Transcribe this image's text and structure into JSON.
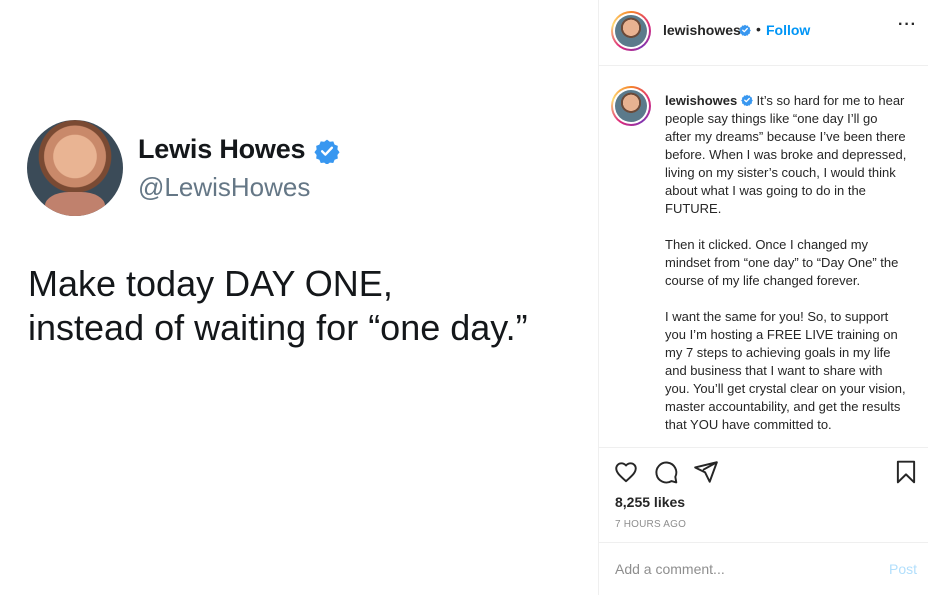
{
  "post_image": {
    "tweet_name": "Lewis Howes",
    "tweet_handle": "@LewisHowes",
    "tweet_line1": "Make today DAY ONE,",
    "tweet_line2": "instead of waiting for “one day.”"
  },
  "header": {
    "username": "lewishowes",
    "separator": "•",
    "follow_label": "Follow",
    "more_label": "···"
  },
  "caption": {
    "username": "lewishowes",
    "paragraph1": "It’s so hard for me to hear people say things like “one day I’ll go after my dreams” because I’ve been there before. When I was broke and depressed, living on my sister’s couch, I would think about what I was going to do in the FUTURE.",
    "paragraph2": "Then it clicked. Once I changed my mindset from “one day” to “Day One” the course of my life changed forever.",
    "paragraph3": "I want the same for you! So, to support you I’m hosting a FREE LIVE training on my 7 steps to achieving goals in my life and business that I want to share with you. You’ll get crystal clear on your vision, master accountability, and get the results that YOU have committed to."
  },
  "actions": {
    "icons": [
      "heart-icon",
      "comment-icon",
      "share-icon",
      "bookmark-icon"
    ],
    "likes": "8,255 likes",
    "time": "7 HOURS AGO"
  },
  "comment": {
    "placeholder": "Add a comment...",
    "post_label": "Post"
  },
  "colors": {
    "accent": "#0095f6",
    "verified": "#3897f0",
    "post_disabled": "#b2dffc",
    "secondary_text": "#8e8e8e"
  }
}
